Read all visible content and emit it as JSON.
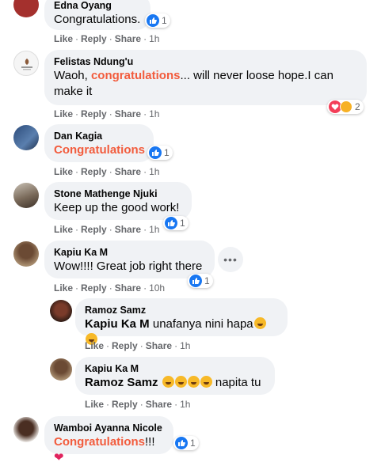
{
  "comments": [
    {
      "author": "Edna Oyang",
      "text": "Congratulations.",
      "actions": {
        "like": "Like",
        "reply": "Reply",
        "share": "Share",
        "time": "1h"
      },
      "reactions": "1"
    },
    {
      "author": "Felistas Ndung'u",
      "text_before": "Waoh, ",
      "highlight": "congratulations",
      "text_after": "... will never loose hope.I can make it",
      "actions": {
        "like": "Like",
        "reply": "Reply",
        "share": "Share",
        "time": "1h"
      },
      "reactions": "2"
    },
    {
      "author": "Dan Kagia",
      "highlight": "Congratulations",
      "actions": {
        "like": "Like",
        "reply": "Reply",
        "share": "Share",
        "time": "1h"
      },
      "reactions": "1"
    },
    {
      "author": "Stone Mathenge Njuki",
      "text": "Keep up the good work!",
      "actions": {
        "like": "Like",
        "reply": "Reply",
        "share": "Share",
        "time": "1h"
      },
      "reactions": "1"
    },
    {
      "author": "Kapiu Ka M",
      "text": "Wow!!!! Great job right there",
      "actions": {
        "like": "Like",
        "reply": "Reply",
        "share": "Share",
        "time": "10h"
      },
      "reactions": "1",
      "more_button": "•••"
    },
    {
      "author": "Wamboi Ayanna Nicole",
      "highlight": "Congratulations",
      "text_after": "!!!",
      "actions": {},
      "reactions": "1"
    }
  ],
  "replies": [
    {
      "author": "Ramoz Samz",
      "mention": "Kapiu Ka M",
      "text_after": " unafanya nini hapa",
      "actions": {
        "like": "Like",
        "reply": "Reply",
        "share": "Share",
        "time": "1h"
      }
    },
    {
      "author": "Kapiu Ka M",
      "mention": "Ramoz Samz",
      "text_after": " napita tu",
      "actions": {
        "like": "Like",
        "reply": "Reply",
        "share": "Share",
        "time": "1h"
      }
    }
  ],
  "colors": {
    "highlight": "#f25c3d",
    "bubble": "#f0f2f5",
    "like": "#1877f2",
    "meta": "#65676b"
  }
}
